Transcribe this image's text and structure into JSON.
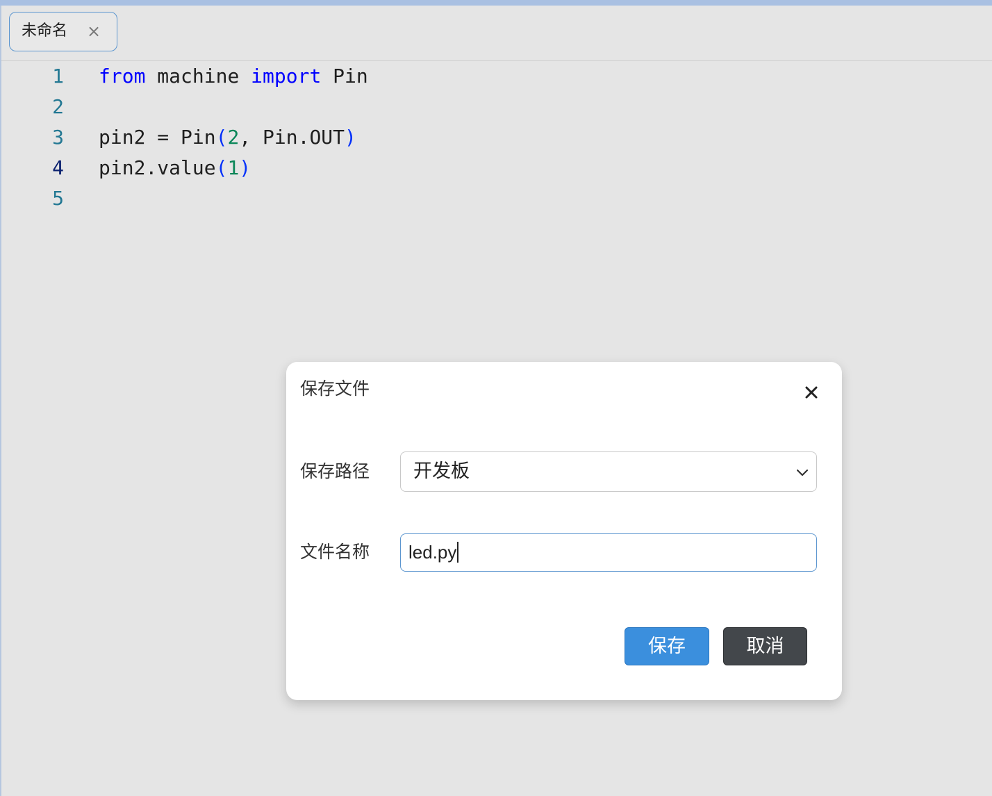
{
  "tabs": [
    {
      "label": "未命名",
      "close_glyph": "×"
    }
  ],
  "editor": {
    "lines": [
      {
        "number": "1"
      },
      {
        "number": "2"
      },
      {
        "number": "3"
      },
      {
        "number": "4"
      },
      {
        "number": "5"
      }
    ],
    "code": {
      "l1_kw_from": "from",
      "l1_module": " machine ",
      "l1_kw_import": "import",
      "l1_name": " Pin",
      "l3_prefix": "pin2 = Pin",
      "l3_open": "(",
      "l3_num": "2",
      "l3_mid": ", Pin.OUT",
      "l3_close": ")",
      "l4_prefix": "pin2.value",
      "l4_open": "(",
      "l4_num": "1",
      "l4_close": ")"
    }
  },
  "dialog": {
    "title": "保存文件",
    "path_label": "保存路径",
    "path_value": "开发板",
    "name_label": "文件名称",
    "name_value": "led.py",
    "save_label": "保存",
    "cancel_label": "取消"
  },
  "colors": {
    "keyword": "#0000ff",
    "number": "#098658",
    "line_number": "#237893",
    "primary_button": "#3b8fdd",
    "secondary_button": "#43474b"
  },
  "icons": {
    "tab_close": "close-icon",
    "dialog_close": "close-icon",
    "select_arrow": "chevron-down-icon"
  }
}
